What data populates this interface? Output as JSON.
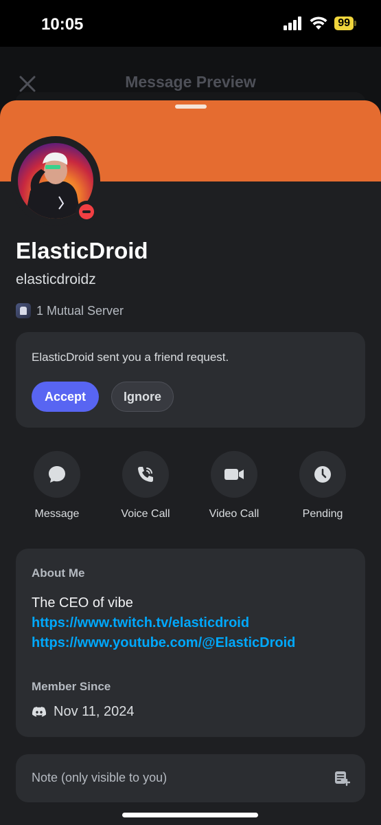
{
  "status_bar": {
    "time": "10:05",
    "battery": "99"
  },
  "modal": {
    "title": "Message Preview"
  },
  "profile": {
    "display_name": "ElasticDroid",
    "username": "elasticdroidz",
    "mutual_servers": "1 Mutual Server",
    "status": "do-not-disturb"
  },
  "friend_request": {
    "text": "ElasticDroid sent you a friend request.",
    "accept_label": "Accept",
    "ignore_label": "Ignore"
  },
  "actions": [
    {
      "label": "Message",
      "icon": "chat-bubble-icon"
    },
    {
      "label": "Voice Call",
      "icon": "phone-icon"
    },
    {
      "label": "Video Call",
      "icon": "video-camera-icon"
    },
    {
      "label": "Pending",
      "icon": "clock-icon"
    }
  ],
  "about": {
    "heading": "About Me",
    "bio": "The CEO of vibe",
    "links": [
      "https://www.twitch.tv/elasticdroid",
      "https://www.youtube.com/@ElasticDroid"
    ],
    "member_since_heading": "Member Since",
    "member_since_date": "Nov 11, 2024"
  },
  "note": {
    "placeholder": "Note (only visible to you)"
  },
  "colors": {
    "banner": "#e56c30",
    "accept": "#5865f2",
    "link": "#00a8fc",
    "dnd": "#f23f43",
    "battery": "#f0d53c"
  }
}
